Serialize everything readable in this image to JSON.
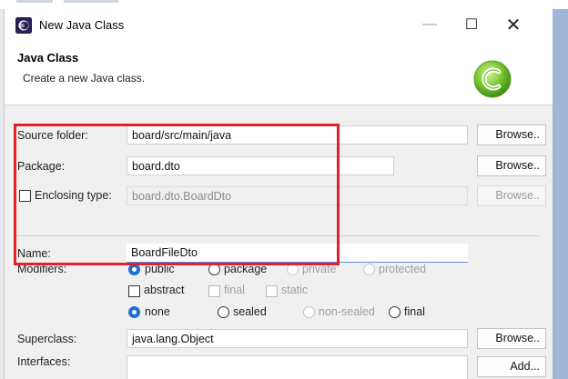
{
  "window": {
    "title": "New Java Class",
    "minimize_glyph": "—",
    "maximize_glyph": "☐",
    "close_glyph": "✕"
  },
  "header": {
    "title": "Java Class",
    "description": "Create a new Java class."
  },
  "form": {
    "source_folder": {
      "label": "Source folder:",
      "value": "board/src/main/java",
      "button": "Browse.."
    },
    "package": {
      "label": "Package:",
      "value": "board.dto",
      "button": "Browse.."
    },
    "enclosing_type": {
      "label": "Enclosing type:",
      "checked": false,
      "value": "board.dto.BoardDto",
      "button": "Browse.."
    },
    "name": {
      "label": "Name:",
      "value": "BoardFileDto"
    },
    "modifiers": {
      "label": "Modifiers:",
      "access": [
        "public",
        "package",
        "private",
        "protected"
      ],
      "access_selected": "public",
      "flags": [
        "abstract",
        "final",
        "static"
      ],
      "sealing": [
        "none",
        "sealed",
        "non-sealed",
        "final"
      ],
      "sealing_selected": "none"
    },
    "superclass": {
      "label": "Superclass:",
      "value": "java.lang.Object",
      "button": "Browse.."
    },
    "interfaces": {
      "label": "Interfaces:",
      "value": "",
      "button": "Add..."
    }
  },
  "colors": {
    "highlight": "#e2202b",
    "radio_selected": "#1f6fd1",
    "focus_underline": "#5a8fd6",
    "background_right": "#9fb6d6"
  },
  "icons": {
    "app": "eclipse-icon",
    "class_logo": "java-class-c-icon"
  }
}
